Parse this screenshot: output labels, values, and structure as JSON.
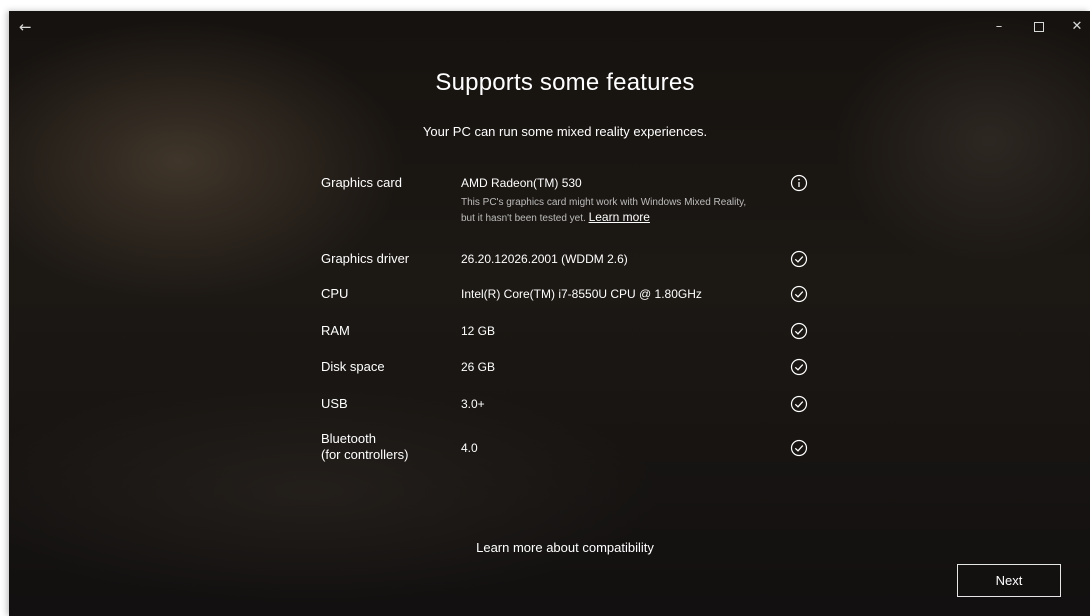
{
  "window": {
    "back_icon": "arrow-left-icon",
    "minimize_glyph": "–",
    "close_glyph": "✕"
  },
  "header": {
    "title": "Supports some features",
    "subtitle": "Your PC can run some mixed reality experiences."
  },
  "requirements": [
    {
      "label": "Graphics card",
      "value": "AMD Radeon(TM) 530",
      "note": "This PC's graphics card might work with Windows Mixed Reality, but it hasn't been tested yet.",
      "note_link": "Learn more",
      "status": "info-icon"
    },
    {
      "label": "Graphics driver",
      "value": "26.20.12026.2001 (WDDM 2.6)",
      "status": "check-circle-icon"
    },
    {
      "label": "CPU",
      "value": "Intel(R) Core(TM) i7-8550U CPU @ 1.80GHz",
      "status": "check-circle-icon"
    },
    {
      "label": "RAM",
      "value": "12 GB",
      "status": "check-circle-icon"
    },
    {
      "label": "Disk space",
      "value": "26 GB",
      "status": "check-circle-icon"
    },
    {
      "label": "USB",
      "value": "3.0+",
      "status": "check-circle-icon"
    },
    {
      "label": "Bluetooth\n(for controllers)",
      "label_line1": "Bluetooth",
      "label_line2": "(for controllers)",
      "value": "4.0",
      "status": "check-circle-icon"
    }
  ],
  "footer": {
    "compat_link": "Learn more about compatibility",
    "next_label": "Next"
  }
}
